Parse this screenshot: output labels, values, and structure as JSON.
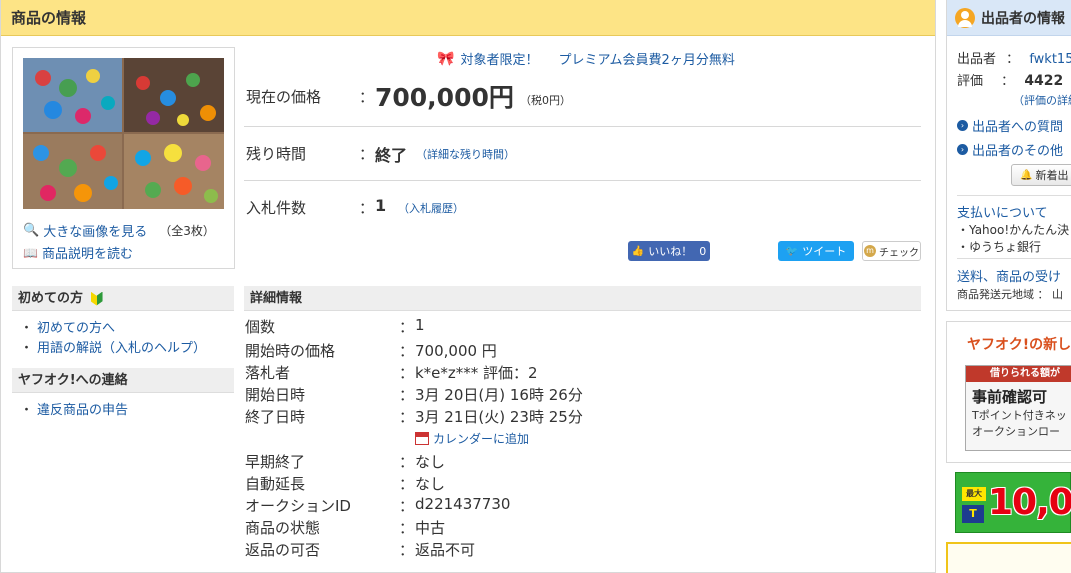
{
  "main": {
    "title": "商品の情報",
    "links": {
      "view_large": "大きな画像を見る",
      "image_count": "（全3枚）",
      "read_desc": "商品説明を読む"
    },
    "promo": {
      "part1": "対象者限定！",
      "part2": "プレミアム会員費2ヶ月分無料"
    },
    "price": {
      "label": "現在の価格",
      "colon": "：",
      "value": "700,000円",
      "tax": "（税0円）"
    },
    "time": {
      "label": "残り時間",
      "colon": "：",
      "value": "終了",
      "detail": "（詳細な残り時間）"
    },
    "bids": {
      "label": "入札件数",
      "colon": "：",
      "value": "1",
      "history": "（入札履歴）"
    },
    "social": {
      "like": "いいね！",
      "like_count": "0",
      "tweet": "ツイート",
      "check": "チェック"
    }
  },
  "sidebar": {
    "first_time": {
      "title": "初めての方",
      "items": [
        "初めての方へ",
        "用語の解説（入札のヘルプ）"
      ]
    },
    "contact": {
      "title": "ヤフオク!への連絡",
      "items": [
        "違反商品の申告"
      ]
    }
  },
  "details": {
    "title": "詳細情報",
    "colon": "：",
    "rows": [
      {
        "key": "個数",
        "value": "1"
      },
      {
        "key": "開始時の価格",
        "value": "700,000 円"
      },
      {
        "key": "落札者",
        "value": "k*e*z*** 評価：2"
      },
      {
        "key": "開始日時",
        "value": "3月 20日(月) 16時 26分"
      },
      {
        "key": "終了日時",
        "value": "3月 21日(火) 23時 25分"
      },
      {
        "key": "早期終了",
        "value": "なし"
      },
      {
        "key": "自動延長",
        "value": "なし"
      },
      {
        "key": "オークションID",
        "value": "d221437730"
      },
      {
        "key": "商品の状態",
        "value": "中古"
      },
      {
        "key": "返品の可否",
        "value": "返品不可"
      }
    ],
    "calendar": "カレンダーに追加"
  },
  "seller": {
    "title": "出品者の情報",
    "seller_label": "出品者",
    "seller_value": "fwkt15",
    "rating_label": "評価",
    "rating_value": "4422",
    "rating_detail": "（評価の詳細",
    "question": "出品者への質問",
    "other": "出品者のその他",
    "notify": "新着出",
    "payment_title": "支払いについて",
    "payments": [
      "Yahoo!かんたん決",
      "ゆうちょ銀行"
    ],
    "shipping_title": "送料、商品の受け",
    "origin": "商品発送元地域 ： 山"
  },
  "ads": {
    "ad1_title": "ヤフオク!の新し",
    "ad1_bar": "借りられる額が",
    "ad1_big": "事前確認可",
    "ad1_line1": "Tポイント付きネッ",
    "ad1_line2": "オークションロー",
    "ad2_max": "最大",
    "ad2_num": "10,00",
    "ad2_logo": "T"
  },
  "colors": {
    "header_bg": "#fde486",
    "link": "#1c5ba2",
    "seller_header_bg": "#d9e7f7"
  }
}
